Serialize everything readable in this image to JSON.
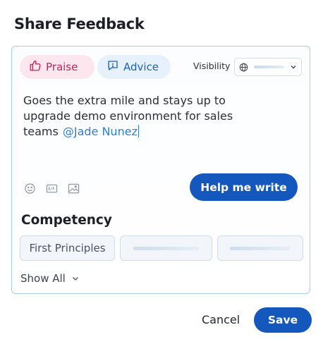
{
  "dialog": {
    "title": "Share Feedback"
  },
  "feedback_type": {
    "options": [
      {
        "label": "Praise",
        "icon": "thumbs-up-icon",
        "selected": true,
        "color": "#c7245a"
      },
      {
        "label": "Advice",
        "icon": "speech-bubble-icon",
        "selected": false,
        "color": "#1d64b8"
      }
    ]
  },
  "visibility": {
    "label": "Visibility",
    "icon": "globe-icon"
  },
  "message": {
    "text": "Goes the extra mile and stays up to upgrade demo environment for sales teams",
    "mention": "@Jade Nunez"
  },
  "toolbar": {
    "icons": [
      "emoji-icon",
      "gif-icon",
      "image-icon"
    ]
  },
  "help_button": {
    "label": "Help me write"
  },
  "competency": {
    "title": "Competency",
    "chips": [
      "First Principles"
    ],
    "show_all_label": "Show All"
  },
  "footer": {
    "cancel_label": "Cancel",
    "save_label": "Save"
  },
  "colors": {
    "accent": "#1457bd",
    "card_border": "#a8cdef"
  }
}
